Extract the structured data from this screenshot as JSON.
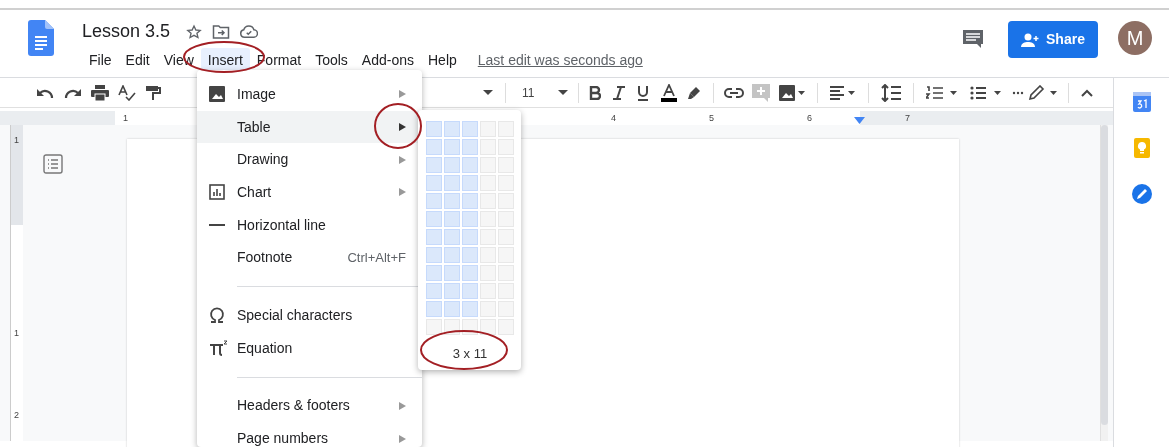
{
  "document": {
    "title": "Lesson 3.5",
    "last_edit": "Last edit was seconds ago"
  },
  "menu_bar": [
    {
      "label": "File",
      "selected": false
    },
    {
      "label": "Edit",
      "selected": false
    },
    {
      "label": "View",
      "selected": false
    },
    {
      "label": "Insert",
      "selected": true
    },
    {
      "label": "Format",
      "selected": false
    },
    {
      "label": "Tools",
      "selected": false
    },
    {
      "label": "Add-ons",
      "selected": false
    },
    {
      "label": "Help",
      "selected": false
    }
  ],
  "share_button": "Share",
  "avatar": "M",
  "toolbar": {
    "font_size": "11"
  },
  "ruler": {
    "marks": [
      "1",
      "4",
      "5",
      "6",
      "7"
    ]
  },
  "vertical_ruler": {
    "marks": [
      "1",
      "1",
      "2"
    ]
  },
  "insert_menu": [
    {
      "kind": "image",
      "label": "Image",
      "submenu": true,
      "selected": false
    },
    {
      "kind": "plain",
      "label": "Table",
      "submenu": true,
      "selected": true
    },
    {
      "kind": "plain",
      "label": "Drawing",
      "submenu": true,
      "selected": false
    },
    {
      "kind": "chart",
      "label": "Chart",
      "submenu": true,
      "selected": false
    },
    {
      "kind": "line",
      "label": "Horizontal line",
      "submenu": false,
      "selected": false
    },
    {
      "kind": "plain",
      "label": "Footnote",
      "shortcut": "Ctrl+Alt+F",
      "submenu": false,
      "selected": false
    },
    {
      "kind": "separator"
    },
    {
      "kind": "omega",
      "label": "Special characters",
      "submenu": false,
      "selected": false
    },
    {
      "kind": "pi",
      "label": "Equation",
      "submenu": false,
      "selected": false
    },
    {
      "kind": "separator"
    },
    {
      "kind": "plain",
      "label": "Headers & footers",
      "submenu": true,
      "selected": false
    },
    {
      "kind": "plain",
      "label": "Page numbers",
      "submenu": true,
      "selected": false
    }
  ],
  "table_picker": {
    "size_label": "3 x 11",
    "rows": [
      [
        true,
        true,
        true,
        false,
        false
      ],
      [
        true,
        true,
        true,
        false,
        false
      ],
      [
        true,
        true,
        true,
        false,
        false
      ],
      [
        true,
        true,
        true,
        false,
        false
      ],
      [
        true,
        true,
        true,
        false,
        false
      ],
      [
        true,
        true,
        true,
        false,
        false
      ],
      [
        true,
        true,
        true,
        false,
        false
      ],
      [
        true,
        true,
        true,
        false,
        false
      ],
      [
        true,
        true,
        true,
        false,
        false
      ],
      [
        true,
        true,
        true,
        false,
        false
      ],
      [
        true,
        true,
        true,
        false,
        false
      ],
      [
        false,
        false,
        false,
        false,
        false
      ]
    ]
  }
}
